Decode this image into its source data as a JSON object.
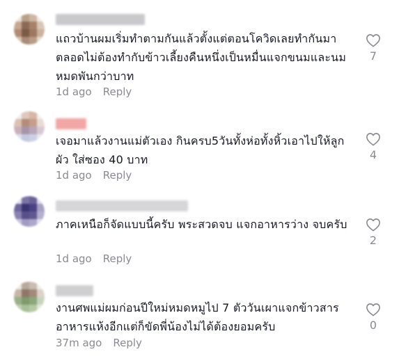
{
  "comments": [
    {
      "text": "แถวบ้านผมเริ่มทำตามกันแล้วตั้งแต่ตอนโควิดเลยทำกันมาตลอดไม่ต้องทำกับข้าวเลี้ยงคืนหนึ่งเป็นหมื่นแจกขนมและนมหมดพันกว่าบาท",
      "time": "1d ago",
      "reply_label": "Reply",
      "likes": "7"
    },
    {
      "text": "เจอมาแล้วงานแม่ตัวเอง กินครบ5วันทั้งห่อทั้งหิ้วเอาไปให้ลูกผัว ใส่ซอง 40 บาท",
      "time": "1d ago",
      "reply_label": "Reply",
      "likes": "4"
    },
    {
      "text": "ภาคเหนือก็จัดแบบนี้ครับ พระสวดจบ แจกอาหารว่าง จบครับ",
      "time": "1d ago",
      "reply_label": "Reply",
      "likes": "2"
    },
    {
      "text": "งานศพแม่ผมก่อนปีใหม่หมดหมูไป 7 ตัววันเผาแจกข้าวสารอาหารแห้งอีกแต่ก็ขัดพี่น้องไม่ได้ต้องยอมครับ",
      "time": "37m ago",
      "reply_label": "Reply",
      "likes": "0"
    }
  ],
  "icons": {
    "like": "heart-outline-icon"
  },
  "colors": {
    "text": "#161823",
    "muted": "#8a8b91",
    "background": "#ffffff"
  }
}
